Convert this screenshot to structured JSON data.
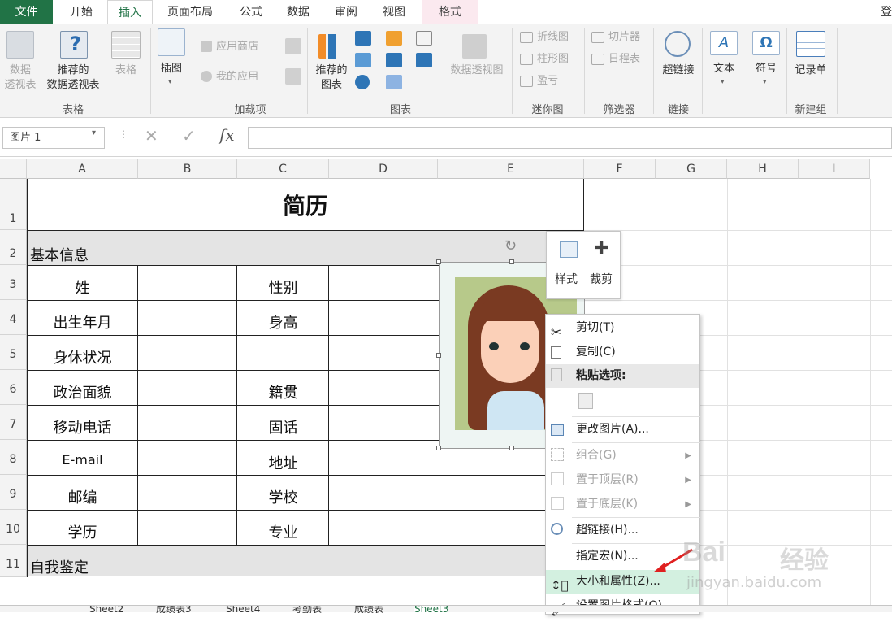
{
  "tabs": {
    "file": "文件",
    "home": "开始",
    "insert": "插入",
    "layout": "页面布局",
    "formulas": "公式",
    "data": "数据",
    "review": "审阅",
    "view": "视图",
    "format": "格式",
    "user": "登"
  },
  "ribbon": {
    "pivot": "数据\n透视表",
    "rec_pivot": "推荐的\n数据透视表",
    "table": "表格",
    "grp_table": "表格",
    "illus": "插图",
    "store": "应用商店",
    "myapps": "我的应用",
    "grp_addins": "加载项",
    "rec_charts": "推荐的\n图表",
    "pivot_chart": "数据透视图",
    "grp_charts": "图表",
    "line": "折线图",
    "column": "柱形图",
    "winloss": "盈亏",
    "grp_spark": "迷你图",
    "slicer": "切片器",
    "timeline": "日程表",
    "grp_filter": "筛选器",
    "hyperlink": "超链接",
    "grp_links": "链接",
    "text": "文本",
    "symbol": "符号",
    "record": "记录单",
    "grp_new": "新建组"
  },
  "namebox": "图片 1",
  "formula_icons": {
    "cancel": "✕",
    "enter": "✓",
    "fx": "fx"
  },
  "columns": [
    "A",
    "B",
    "C",
    "D",
    "E",
    "F",
    "G",
    "H",
    "I"
  ],
  "rows": [
    "1",
    "2",
    "3",
    "4",
    "5",
    "6",
    "7",
    "8",
    "9",
    "10",
    "11"
  ],
  "sheet": {
    "title": "简历",
    "basic": "基本信息",
    "self": "自我鉴定",
    "name": "姓",
    "birth": "出生年月",
    "health": "身休状况",
    "politics": "政治面貌",
    "mobile": "移动电话",
    "email": "E-mail",
    "zip": "邮编",
    "edu": "学历",
    "gender": "性别",
    "height": "身高",
    "origin": "籍贯",
    "phone": "固话",
    "address": "地址",
    "school": "学校",
    "major": "专业"
  },
  "mini": {
    "style": "样式",
    "crop": "裁剪"
  },
  "menu": {
    "cut": "剪切(T)",
    "copy": "复制(C)",
    "paste": "粘贴选项:",
    "change": "更改图片(A)...",
    "group": "组合(G)",
    "front": "置于顶层(R)",
    "back": "置于底层(K)",
    "link": "超链接(H)...",
    "macro": "指定宏(N)...",
    "size": "大小和属性(Z)...",
    "format": "设置图片格式(O)..."
  },
  "sheet_tabs": [
    "Sheet2",
    "成绩表3",
    "Sheet4",
    "考勤表",
    "成绩表",
    "Sheet3"
  ],
  "watermark": {
    "brand": "Bai",
    "brand2": "经验",
    "url": "jingyan.baidu.com"
  }
}
